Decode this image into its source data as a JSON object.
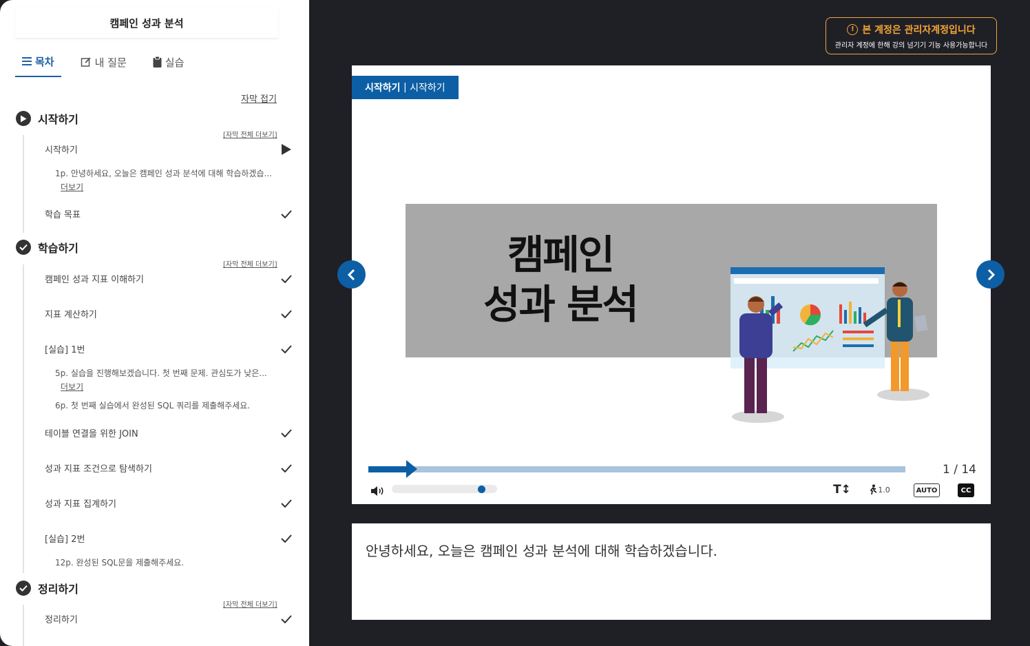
{
  "course": {
    "title": "캠페인 성과 분석"
  },
  "tabs": [
    {
      "label": "목차",
      "icon": "list-icon"
    },
    {
      "label": "내 질문",
      "icon": "edit-icon"
    },
    {
      "label": "실습",
      "icon": "clipboard-icon"
    }
  ],
  "sidebar": {
    "collapse_label": "자막 접기",
    "more_all_label": "[자막 전체 더보기]",
    "more_label": "더보기",
    "sections": [
      {
        "title": "시작하기",
        "status": "play",
        "items": [
          {
            "label": "시작하기",
            "status": "playing",
            "subs": [
              "1p. 안녕하세요, 오늘은 캠페인 성과 분석에 대해 학습하겠습..."
            ]
          },
          {
            "label": "학습 목표",
            "status": "done"
          }
        ]
      },
      {
        "title": "학습하기",
        "status": "done",
        "items": [
          {
            "label": "캠페인 성과 지표 이해하기",
            "status": "done"
          },
          {
            "label": "지표 계산하기",
            "status": "done"
          },
          {
            "label": "[실습] 1번",
            "status": "done",
            "subs": [
              "5p. 실습을 진행해보겠습니다. 첫 번째 문제. 관심도가 낮은...",
              "6p. 첫 번째 실습에서 완성된 SQL 쿼리를 제출해주세요."
            ]
          },
          {
            "label": "테이블 연결을 위한 JOIN",
            "status": "done"
          },
          {
            "label": "성과 지표 조건으로 탐색하기",
            "status": "done"
          },
          {
            "label": "성과 지표 집계하기",
            "status": "done"
          },
          {
            "label": "[실습] 2번",
            "status": "done",
            "subs": [
              "12p. 완성된 SQL문을 제출해주세요."
            ]
          }
        ]
      },
      {
        "title": "정리하기",
        "status": "done",
        "items": [
          {
            "label": "정리하기",
            "status": "done"
          }
        ]
      }
    ]
  },
  "admin_notice": {
    "title": "본 계정은 관리자계정입니다",
    "subtitle": "관리자 계정에 한해 강의 넘기기 기능 사용가능합니다",
    "color": "#f5a636"
  },
  "player": {
    "chapter_bold": "시작하기",
    "chapter_sep": " | ",
    "chapter_sub": "시작하기",
    "slide_title_line1": "캠페인",
    "slide_title_line2": "성과 분석",
    "page_counter": "1 / 14",
    "progress": 0.07,
    "volume": 0.88,
    "speed_label": "1.0",
    "auto_label": "AUTO",
    "cc_label": "CC",
    "text_size_label": "T↕",
    "accent": "#0d5fa5"
  },
  "caption": {
    "text": "안녕하세요, 오늘은 캠페인 성과 분석에 대해 학습하겠습니다."
  }
}
